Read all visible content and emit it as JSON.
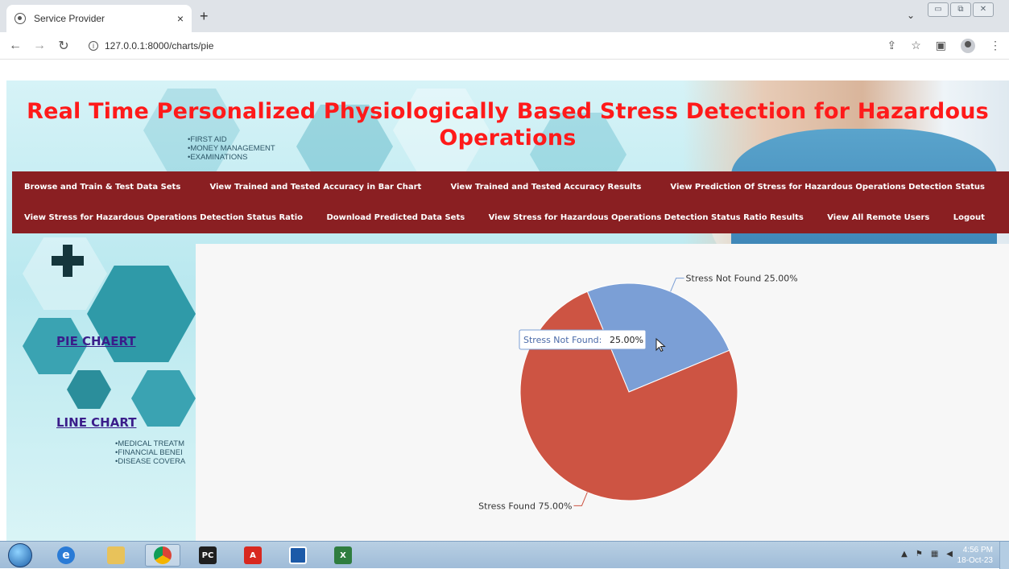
{
  "browser": {
    "tab_title": "Service Provider",
    "tab_close": "×",
    "new_tab": "+",
    "url": "127.0.0.1:8000/charts/pie",
    "window_controls": [
      "▭",
      "⧉",
      "✕"
    ]
  },
  "header": {
    "title": "Real Time Personalized Physiologically Based Stress Detection for Hazardous Operations",
    "deco_top": "•FIRST AID\n•MONEY MANAGEMENT\n•EXAMINATIONS",
    "deco_bottom": "•MEDICAL TREATM\n•FINANCIAL BENEI\n•DISEASE COVERA"
  },
  "menu": {
    "row1": [
      "Browse and Train & Test Data Sets",
      "View Trained and Tested Accuracy in Bar Chart",
      "View Trained and Tested Accuracy Results",
      "View Prediction Of Stress for Hazardous Operations Detection Status"
    ],
    "row2": [
      "View Stress for Hazardous Operations Detection Status Ratio",
      "Download Predicted Data Sets",
      "View Stress for Hazardous Operations Detection Status Ratio Results",
      "View All Remote Users",
      "Logout"
    ]
  },
  "sidebar": {
    "pie_link": "PIE CHAERT",
    "line_link": "LINE CHART"
  },
  "chart_data": {
    "type": "pie",
    "slices": [
      {
        "label": "Stress Not Found",
        "value": 25.0,
        "display": "Stress Not Found 25.00%",
        "color": "#7b9fd6"
      },
      {
        "label": "Stress Found",
        "value": 75.0,
        "display": "Stress Found 75.00%",
        "color": "#cd5443"
      }
    ],
    "tooltip": {
      "label": "Stress Not Found:",
      "value": "25.00%"
    }
  },
  "taskbar": {
    "time": "4:56 PM",
    "date": "18-Oct-23",
    "apps": [
      "internet-explorer",
      "file-explorer",
      "chrome",
      "pycharm",
      "acrobat",
      "remote-app",
      "excel"
    ]
  },
  "colors": {
    "title_red": "#ff1a1a",
    "menu_bg": "#8a1f22",
    "link_purple": "#3a1d8a"
  }
}
